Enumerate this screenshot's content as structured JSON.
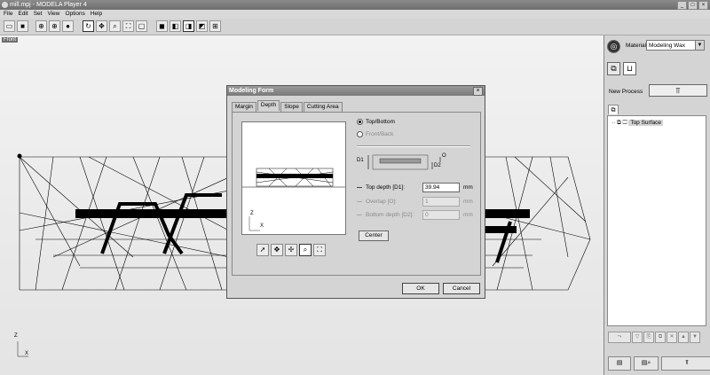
{
  "window": {
    "title": "mill.mpj - MODELA Player 4",
    "controls": [
      "_",
      "□",
      "×"
    ]
  },
  "menu": [
    "File",
    "Edit",
    "Set",
    "View",
    "Options",
    "Help"
  ],
  "toolbar": {
    "icons": [
      "open-icon",
      "save-icon",
      "view-front-icon",
      "view-top-icon",
      "shade-icon",
      "rotate-icon",
      "pan-icon",
      "zoom-icon",
      "fit-icon",
      "box-icon",
      "solid-icon",
      "wireframe-icon",
      "side-icon",
      "grid-icon"
    ]
  },
  "viewport": {
    "view_label": "Front",
    "axis_z": "Z",
    "axis_x": "X"
  },
  "right_panel": {
    "material_label": "Material",
    "material_value": "Modeling Wax",
    "new_process_label": "New Process",
    "tree_item": "Top Surface"
  },
  "dialog": {
    "title": "Modeling Form",
    "close": "×",
    "tabs": [
      "Margin",
      "Depth",
      "Slope",
      "Cutting Area"
    ],
    "active_tab": "Depth",
    "radio_top_bottom": "Top/Bottom",
    "radio_front_back": "Front/Back",
    "fig_d1": "D1",
    "fig_d2": "D2",
    "fig_o": "O",
    "top_depth_label": "Top depth [D1]:",
    "top_depth_value": "39.94",
    "overlap_label": "Overlap [O]:",
    "overlap_value": "1",
    "bottom_depth_label": "Bottom depth [D2]:",
    "bottom_depth_value": "0",
    "unit": "mm",
    "center_button": "Center",
    "ok_button": "OK",
    "cancel_button": "Cancel",
    "preview_axis_z": "Z",
    "preview_axis_x": "X"
  }
}
